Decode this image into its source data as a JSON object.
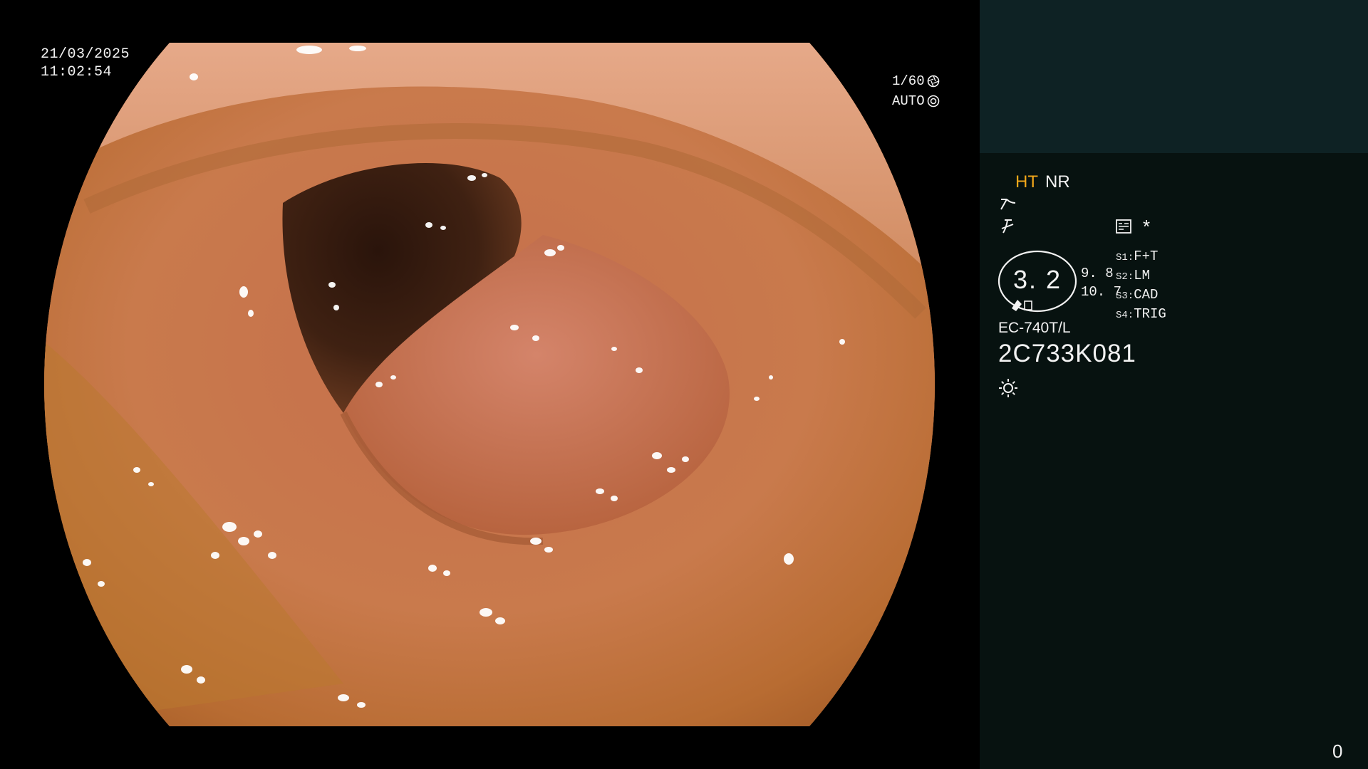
{
  "overlay": {
    "date": "21/03/2025",
    "time": "11:02:54",
    "shutter_speed": "1/60",
    "exposure_mode": "AUTO"
  },
  "panel": {
    "mode_ht": "HT",
    "mode_nr": "NR",
    "star": "*",
    "zoom_value": "3. 2",
    "zoom_side_top": "9. 8",
    "zoom_side_bottom": "10. 7",
    "switches": [
      {
        "key": "S1:",
        "value": "F+T"
      },
      {
        "key": "S2:",
        "value": "LM"
      },
      {
        "key": "S3:",
        "value": "CAD"
      },
      {
        "key": "S4:",
        "value": "TRIG"
      }
    ],
    "scope_model": "EC-740T/L",
    "scope_serial": "2C733K081",
    "counter": "0"
  },
  "colors": {
    "ht_accent": "#f2a71a",
    "panel_bg": "#071210",
    "panel_top_bg": "#0e2224"
  },
  "icons": {
    "shutter": "aperture-icon",
    "exposure": "iris-icon",
    "structure": "structure-enhance-icon",
    "contrast": "contrast-icon",
    "memory": "memory-card-icon",
    "light": "light-source-icon"
  }
}
